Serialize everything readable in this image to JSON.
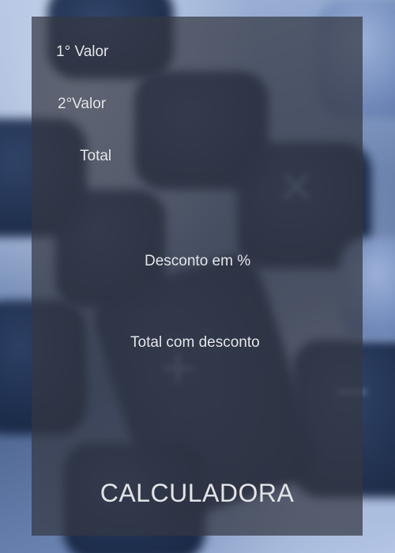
{
  "form": {
    "value1_label": "1° Valor",
    "value2_label": "2°Valor",
    "total_label": "Total",
    "discount_label": "Desconto em %",
    "total_discount_label": "Total com desconto"
  },
  "app": {
    "title": "CALCULADORA"
  },
  "colors": {
    "panel": "#343842",
    "text": "#e6e8ec",
    "background_accent": "#4f6692"
  }
}
